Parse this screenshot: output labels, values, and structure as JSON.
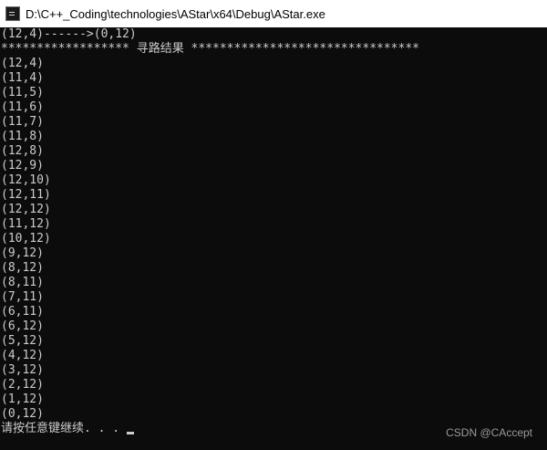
{
  "window": {
    "title": "D:\\C++_Coding\\technologies\\AStar\\x64\\Debug\\AStar.exe",
    "icon": "console-app-icon"
  },
  "console": {
    "header_line": "(12,4)------>(0,12)",
    "result_line": "****************** 寻路结果 ********************************",
    "path": [
      "(12,4)",
      "(11,4)",
      "(11,5)",
      "(11,6)",
      "(11,7)",
      "(11,8)",
      "(12,8)",
      "(12,9)",
      "(12,10)",
      "(12,11)",
      "(12,12)",
      "(11,12)",
      "(10,12)",
      "(9,12)",
      "(8,12)",
      "(8,11)",
      "(7,11)",
      "(6,11)",
      "(6,12)",
      "(5,12)",
      "(4,12)",
      "(3,12)",
      "(2,12)",
      "(1,12)",
      "(0,12)"
    ],
    "prompt": "请按任意键继续. . ."
  },
  "watermark": "CSDN @CAccept",
  "colors": {
    "console_bg": "#0c0c0c",
    "console_text": "#cccccc",
    "titlebar_bg": "#ffffff"
  }
}
